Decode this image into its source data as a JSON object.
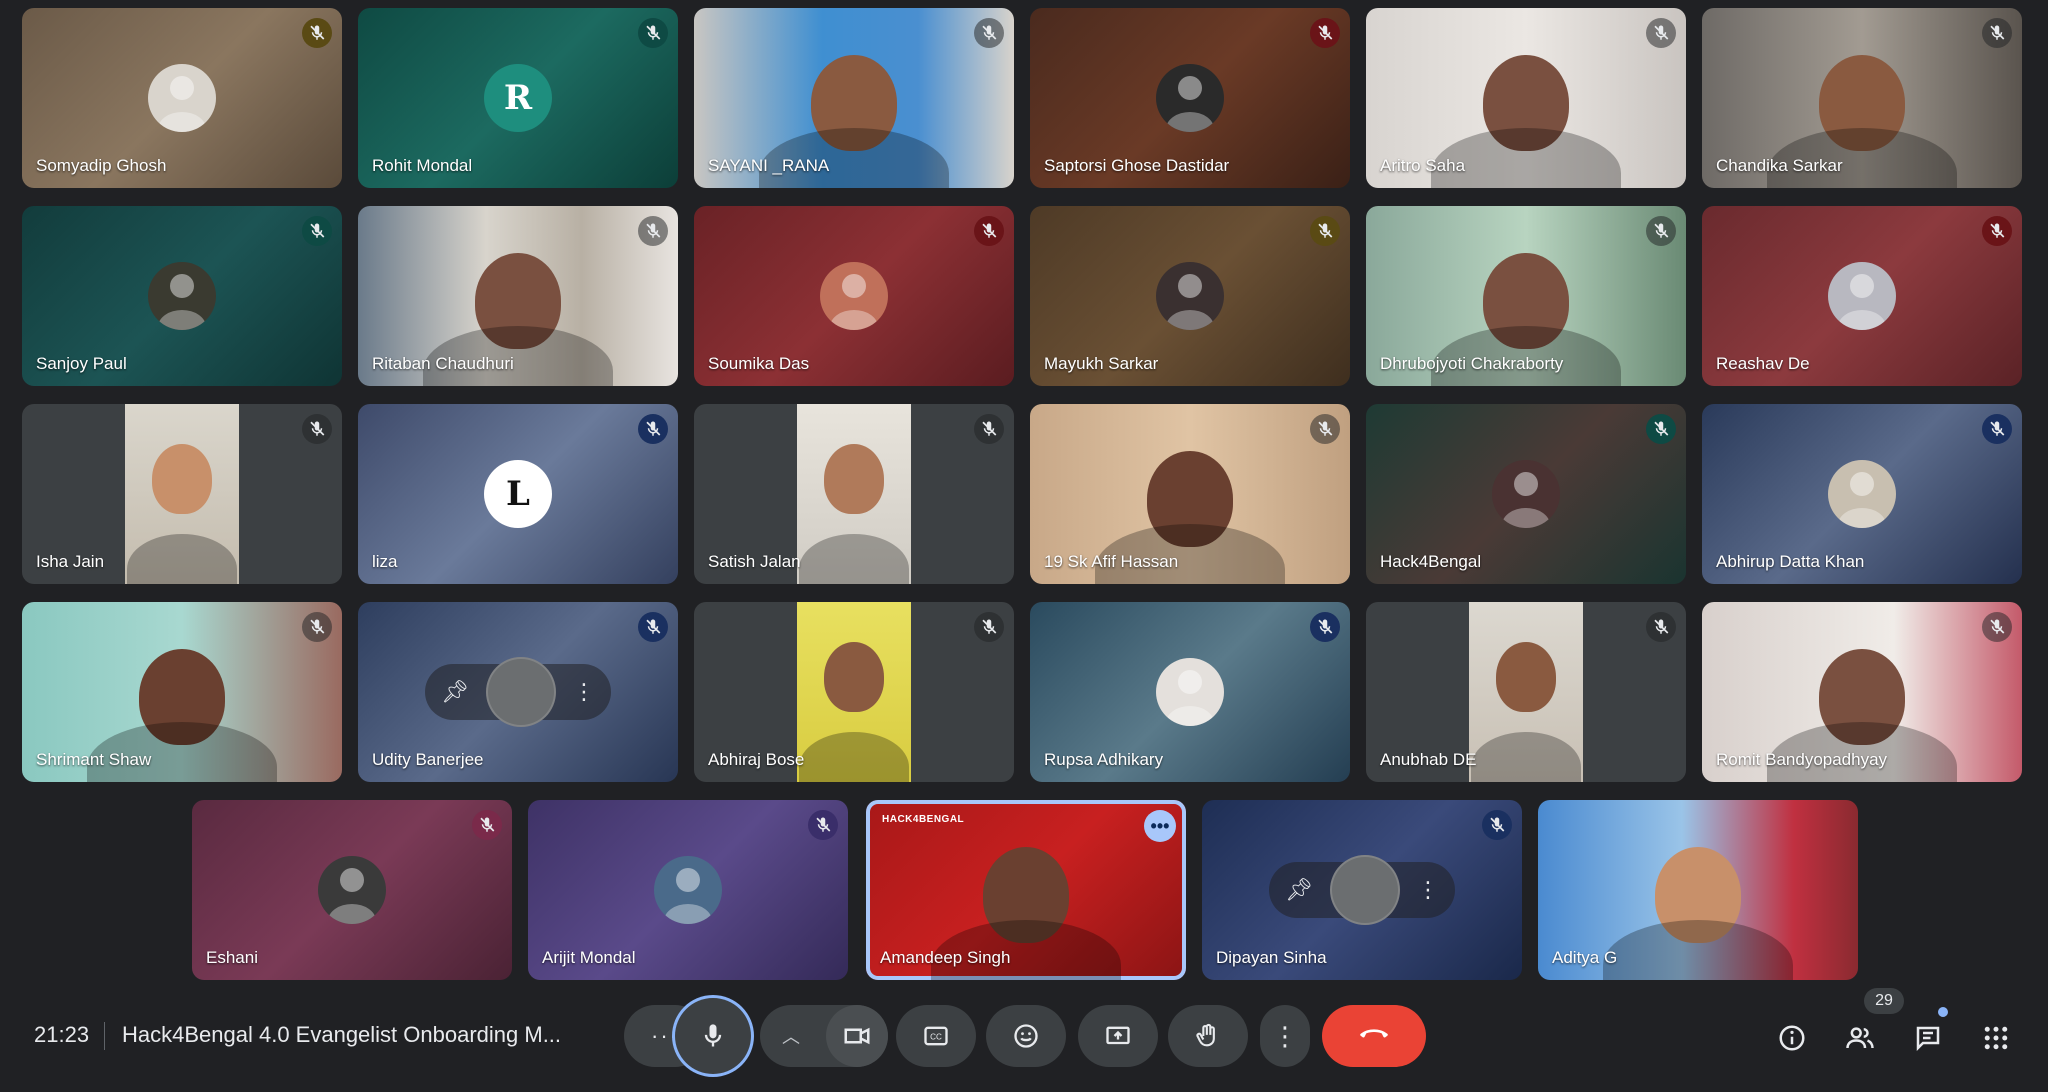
{
  "participants": [
    {
      "name": "Somyadip Ghosh",
      "muted": true,
      "mic_style": "yellow",
      "bg": "linear-gradient(135deg,#6b5a48,#8a765f 50%,#5a4a3a)",
      "kind": "avatar",
      "avatar_bg": "#d9d4cc"
    },
    {
      "name": "Rohit Mondal",
      "muted": true,
      "mic_style": "teal",
      "bg": "linear-gradient(135deg,#0f4a43,#1c6a60 50%,#0c3e38)",
      "kind": "letter",
      "letter": "R",
      "avatar_bg": "#1e8e7e"
    },
    {
      "name": "SAYANI _RANA",
      "muted": true,
      "mic_style": "dark",
      "bg": "linear-gradient(90deg,#c9c6c2,#3f8fd1 40%,#4a8fd0 70%,#d8d3cc)",
      "kind": "video",
      "skin": "#8a5a40"
    },
    {
      "name": "Saptorsi Ghose Dastidar",
      "muted": true,
      "mic_style": "red",
      "bg": "linear-gradient(135deg,#4a2a1e,#6a3a26 50%,#3a2016)",
      "kind": "avatar",
      "avatar_bg": "#2a2a2a"
    },
    {
      "name": "Aritro Saha",
      "muted": true,
      "mic_style": "dark",
      "bg": "linear-gradient(90deg,#d8d4d0,#ebe7e3 50%,#c9c4c0)",
      "kind": "video",
      "skin": "#7a5040"
    },
    {
      "name": "Chandika Sarkar",
      "muted": true,
      "mic_style": "dark",
      "bg": "linear-gradient(90deg,#6e6a66,#a29b92 50%,#5a544e)",
      "kind": "video",
      "skin": "#8a5a40"
    },
    {
      "name": "Sanjoy Paul",
      "muted": true,
      "mic_style": "teal",
      "bg": "linear-gradient(135deg,#123c3c,#1c5454 50%,#0f3434)",
      "kind": "avatar",
      "avatar_bg": "#3a3a30"
    },
    {
      "name": "Ritaban Chaudhuri",
      "muted": true,
      "mic_style": "dark",
      "bg": "linear-gradient(90deg,#6a7a8a,#d8d4cc 40%,#b8b0a4 70%,#e8e4e0)",
      "kind": "video",
      "skin": "#7a5040"
    },
    {
      "name": "Soumika Das",
      "muted": true,
      "mic_style": "red",
      "bg": "linear-gradient(135deg,#6a2226,#8c3034 50%,#5a1c20)",
      "kind": "avatar",
      "avatar_bg": "#c0705a"
    },
    {
      "name": "Mayukh Sarkar",
      "muted": true,
      "mic_style": "yellow",
      "bg": "linear-gradient(135deg,#4e3a26,#6a5034 50%,#3e2e1e)",
      "kind": "avatar",
      "avatar_bg": "#3a3030"
    },
    {
      "name": "Dhrubojyoti Chakraborty",
      "muted": true,
      "mic_style": "dark",
      "bg": "linear-gradient(90deg,#8aa89a,#b8d4c0 50%,#6a8a74)",
      "kind": "video",
      "skin": "#7a5040"
    },
    {
      "name": "Reashav De",
      "muted": true,
      "mic_style": "red",
      "bg": "linear-gradient(135deg,#6a2a2e,#8c3a3e 50%,#5a2226)",
      "kind": "avatar",
      "avatar_bg": "#b8b8c0"
    },
    {
      "name": "Isha Jain",
      "muted": true,
      "mic_style": "dark",
      "bg": "#3c4043",
      "kind": "portrait",
      "portrait_bg": "linear-gradient(180deg,#dad6cc,#c4bcae)",
      "skin": "#c8906a"
    },
    {
      "name": "liza",
      "muted": true,
      "mic_style": "blue",
      "bg": "linear-gradient(135deg,#3e4a6a,#6a7a9a 50%,#34405e)",
      "kind": "letter",
      "letter": "L",
      "avatar_bg": "#ffffff",
      "letter_color": "#111"
    },
    {
      "name": "Satish Jalan",
      "muted": true,
      "mic_style": "dark",
      "bg": "#3c4043",
      "kind": "portrait",
      "portrait_bg": "linear-gradient(180deg,#e8e4dc,#d0ccc4)",
      "skin": "#b07a5a"
    },
    {
      "name": "19 Sk Afif Hassan",
      "muted": true,
      "mic_style": "dark",
      "bg": "linear-gradient(90deg,#c8a888,#e0c4a4 50%,#c0a080)",
      "kind": "video",
      "skin": "#6a4030"
    },
    {
      "name": "Hack4Bengal",
      "muted": true,
      "mic_style": "teal",
      "bg": "linear-gradient(135deg,#1e3a34,#4a3a36 50%,#1a3430)",
      "kind": "avatar",
      "avatar_bg": "#4a3232"
    },
    {
      "name": "Abhirup Datta Khan",
      "muted": true,
      "mic_style": "blue",
      "bg": "linear-gradient(135deg,#2a3a5a,#5a6a8a 50%,#24304e)",
      "kind": "avatar",
      "avatar_bg": "#c8bfb0"
    },
    {
      "name": "Shrimant Shaw",
      "muted": true,
      "mic_style": "dark",
      "bg": "linear-gradient(90deg,#8ac8c0,#a8d8d0 50%,#9a6a60)",
      "kind": "video",
      "skin": "#6a4030"
    },
    {
      "name": "Udity Banerjee",
      "muted": true,
      "mic_style": "blue",
      "bg": "linear-gradient(135deg,#2e3e5e,#5a6a8a 50%,#283654)",
      "kind": "hover"
    },
    {
      "name": "Abhiraj Bose",
      "muted": true,
      "mic_style": "dark",
      "bg": "#3c4043",
      "kind": "portrait",
      "portrait_bg": "linear-gradient(180deg,#e8e060,#d8cc40)",
      "skin": "#8a5a40"
    },
    {
      "name": "Rupsa Adhikary",
      "muted": true,
      "mic_style": "blue",
      "bg": "linear-gradient(135deg,#2a4a5e,#5a7a8a 50%,#243e52)",
      "kind": "avatar",
      "avatar_bg": "#e4e0dc"
    },
    {
      "name": "Anubhab DE",
      "muted": true,
      "mic_style": "dark",
      "bg": "#3c4043",
      "kind": "portrait",
      "portrait_bg": "linear-gradient(180deg,#dcd8d0,#c8c0b4)",
      "skin": "#8a5a40"
    },
    {
      "name": "Romit Bandyopadhyay",
      "muted": true,
      "mic_style": "dark",
      "bg": "linear-gradient(90deg,#d8d0cc,#f0ece8 60%,#c45a6a)",
      "kind": "video",
      "skin": "#7a5040"
    },
    {
      "name": "Eshani",
      "muted": true,
      "mic_style": "pink",
      "bg": "linear-gradient(135deg,#5a2a40,#7a3a56 50%,#4a2234)",
      "kind": "avatar",
      "avatar_bg": "#3a3a3a"
    },
    {
      "name": "Arijit Mondal",
      "muted": true,
      "mic_style": "purple",
      "bg": "linear-gradient(135deg,#3e3266,#5a4a8a 50%,#342a58)",
      "kind": "avatar",
      "avatar_bg": "#4a6a8a"
    },
    {
      "name": "Amandeep Singh",
      "muted": false,
      "speaking": true,
      "mic_style": "none",
      "bg": "linear-gradient(135deg,#a81818,#c82020 50%,#8a1414)",
      "kind": "video",
      "skin": "#6a4030",
      "brand": "HACK4BENGAL"
    },
    {
      "name": "Dipayan Sinha",
      "muted": true,
      "mic_style": "blue",
      "bg": "linear-gradient(135deg,#1e2e54,#3a4a7a 50%,#1a284a)",
      "kind": "hover"
    },
    {
      "name": "Aditya G",
      "muted": false,
      "mic_style": "none",
      "bg": "linear-gradient(90deg,#4a8ad0,#9ac4e8 45%,#c03040 80%,#8a2a30)",
      "kind": "video",
      "skin": "#c8906a"
    }
  ],
  "bottom_bar": {
    "clock": "21:23",
    "meeting_title": "Hack4Bengal 4.0 Evangelist Onboarding M...",
    "participant_count": "29",
    "icons": {
      "more_options": "more-options-icon",
      "mic": "microphone-icon",
      "camera_options": "chevron-up-icon",
      "camera": "video-camera-icon",
      "captions": "captions-icon",
      "emoji": "emoji-icon",
      "present": "present-screen-icon",
      "raise_hand": "raise-hand-icon",
      "more": "more-vertical-icon",
      "leave": "end-call-icon",
      "info": "info-icon",
      "people": "people-icon",
      "chat": "chat-icon",
      "activities": "apps-grid-icon"
    }
  },
  "colors": {
    "background": "#202124",
    "control": "#3c4043",
    "accent": "#8ab4f8",
    "end_call": "#ea4335",
    "mic_yellow": "#5a4a14",
    "mic_teal": "#0e4a44",
    "mic_red": "#6a1418",
    "mic_blue": "#1a3060",
    "mic_pink": "#7a2a4a",
    "mic_purple": "#3a2e6a"
  }
}
